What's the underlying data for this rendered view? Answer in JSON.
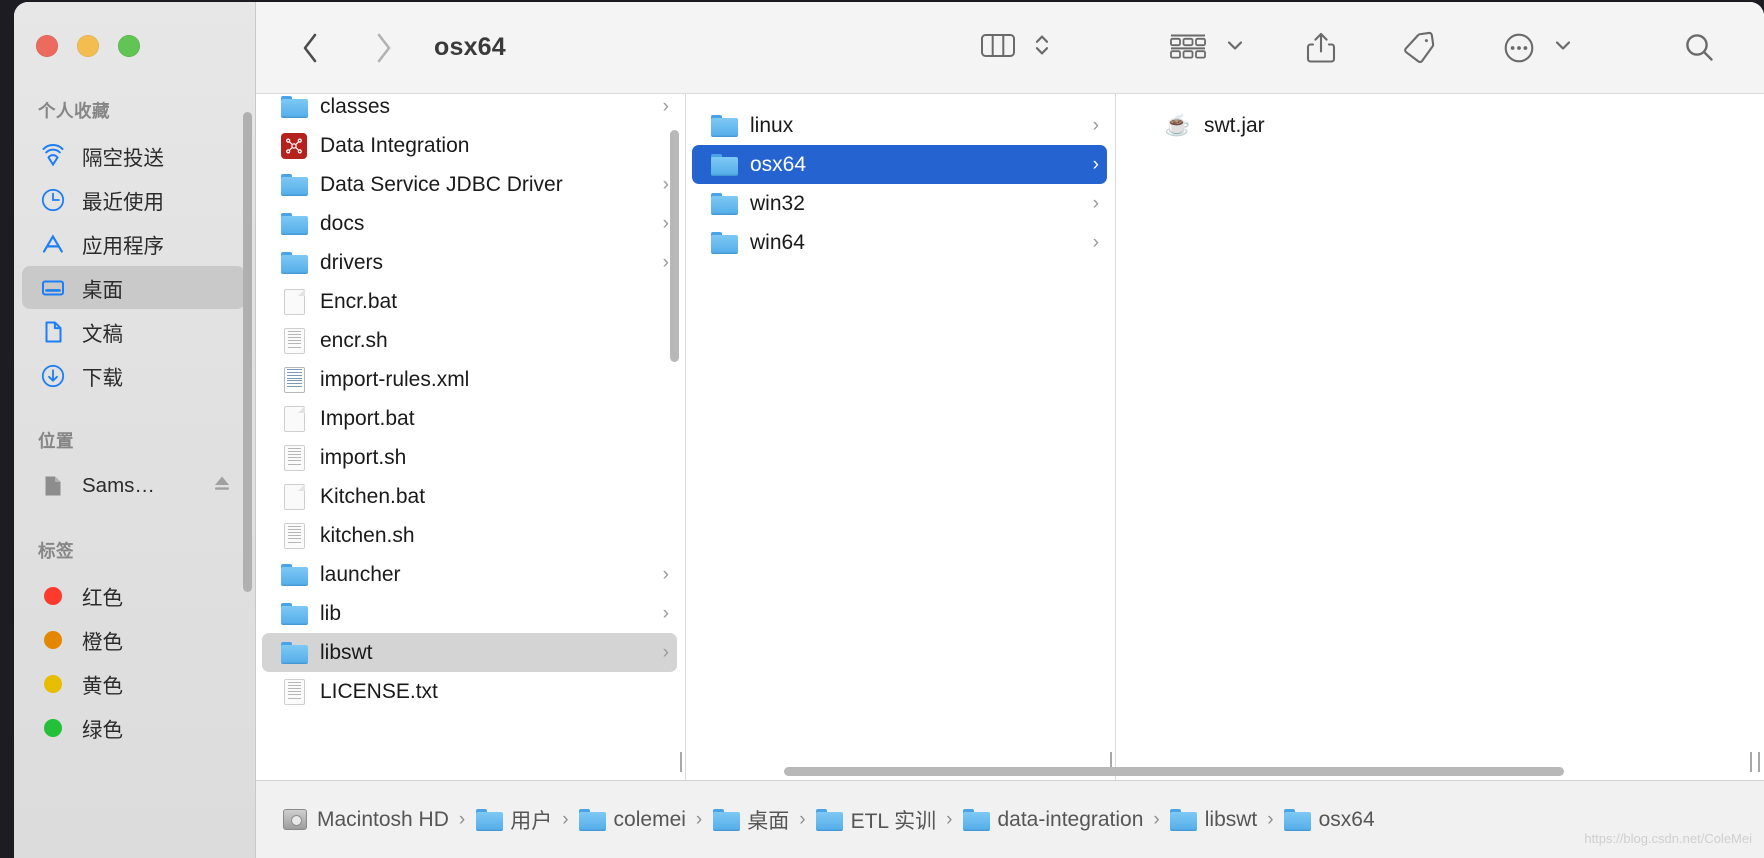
{
  "window": {
    "title": "osx64",
    "traffic_lights": [
      "close",
      "minimize",
      "zoom"
    ]
  },
  "toolbar": {
    "back_label": "‹",
    "forward_label": "›",
    "view_icon": "column-view-icon",
    "sort_icon": "group-by-icon",
    "share_icon": "share-icon",
    "tag_icon": "tag-icon",
    "more_icon": "more-ellipsis-icon",
    "search_icon": "search-icon"
  },
  "sidebar": {
    "sections": [
      {
        "header": "个人收藏",
        "items": [
          {
            "label": "隔空投送",
            "icon": "airdrop-icon",
            "selected": false
          },
          {
            "label": "最近使用",
            "icon": "clock-icon",
            "selected": false
          },
          {
            "label": "应用程序",
            "icon": "applications-icon",
            "selected": false
          },
          {
            "label": "桌面",
            "icon": "desktop-icon",
            "selected": true
          },
          {
            "label": "文稿",
            "icon": "documents-icon",
            "selected": false
          },
          {
            "label": "下载",
            "icon": "downloads-icon",
            "selected": false
          }
        ]
      },
      {
        "header": "位置",
        "items": [
          {
            "label": "Sams…",
            "icon": "disk-icon",
            "selected": false,
            "eject": true
          }
        ]
      },
      {
        "header": "标签",
        "items": [
          {
            "label": "红色",
            "icon": "tag-dot-icon",
            "color": "#fc3b2d",
            "selected": false
          },
          {
            "label": "橙色",
            "icon": "tag-dot-icon",
            "color": "#e38600",
            "selected": false
          },
          {
            "label": "黄色",
            "icon": "tag-dot-icon",
            "color": "#e8bc00",
            "selected": false
          },
          {
            "label": "绿色",
            "icon": "tag-dot-icon",
            "color": "#23c03a",
            "selected": false
          }
        ]
      }
    ]
  },
  "columns": [
    {
      "name": "column-1",
      "items": [
        {
          "label": "classes",
          "icon": "folder-icon",
          "disclosure": true,
          "selection": "none"
        },
        {
          "label": "Data Integration",
          "icon": "app-icon",
          "disclosure": false,
          "selection": "none"
        },
        {
          "label": "Data Service JDBC Driver",
          "icon": "folder-icon",
          "disclosure": true,
          "selection": "none"
        },
        {
          "label": "docs",
          "icon": "folder-icon",
          "disclosure": true,
          "selection": "none"
        },
        {
          "label": "drivers",
          "icon": "folder-icon",
          "disclosure": true,
          "selection": "none"
        },
        {
          "label": "Encr.bat",
          "icon": "document-icon",
          "disclosure": false,
          "selection": "none"
        },
        {
          "label": "encr.sh",
          "icon": "script-icon",
          "disclosure": false,
          "selection": "none"
        },
        {
          "label": "import-rules.xml",
          "icon": "xml-icon",
          "disclosure": false,
          "selection": "none"
        },
        {
          "label": "Import.bat",
          "icon": "document-icon",
          "disclosure": false,
          "selection": "none"
        },
        {
          "label": "import.sh",
          "icon": "script-icon",
          "disclosure": false,
          "selection": "none"
        },
        {
          "label": "Kitchen.bat",
          "icon": "document-icon",
          "disclosure": false,
          "selection": "none"
        },
        {
          "label": "kitchen.sh",
          "icon": "script-icon",
          "disclosure": false,
          "selection": "none"
        },
        {
          "label": "launcher",
          "icon": "folder-icon",
          "disclosure": true,
          "selection": "none"
        },
        {
          "label": "lib",
          "icon": "folder-icon",
          "disclosure": true,
          "selection": "none"
        },
        {
          "label": "libswt",
          "icon": "folder-icon",
          "disclosure": true,
          "selection": "gray"
        },
        {
          "label": "LICENSE.txt",
          "icon": "script-icon",
          "disclosure": false,
          "selection": "none"
        }
      ]
    },
    {
      "name": "column-2",
      "items": [
        {
          "label": "linux",
          "icon": "folder-icon",
          "disclosure": true,
          "selection": "none"
        },
        {
          "label": "osx64",
          "icon": "folder-icon",
          "disclosure": true,
          "selection": "blue"
        },
        {
          "label": "win32",
          "icon": "folder-icon",
          "disclosure": true,
          "selection": "none"
        },
        {
          "label": "win64",
          "icon": "folder-icon",
          "disclosure": true,
          "selection": "none"
        }
      ]
    },
    {
      "name": "column-3",
      "items": [
        {
          "label": "swt.jar",
          "icon": "jar-icon",
          "disclosure": false,
          "selection": "none"
        }
      ]
    }
  ],
  "pathbar": {
    "crumbs": [
      {
        "label": "Macintosh HD",
        "icon": "hard-disk-icon"
      },
      {
        "label": "用户",
        "icon": "users-folder-icon"
      },
      {
        "label": "colemei",
        "icon": "home-folder-icon"
      },
      {
        "label": "桌面",
        "icon": "desktop-folder-icon"
      },
      {
        "label": "ETL 实训",
        "icon": "folder-icon"
      },
      {
        "label": "data-integration",
        "icon": "folder-icon"
      },
      {
        "label": "libswt",
        "icon": "folder-icon"
      },
      {
        "label": "osx64",
        "icon": "folder-icon"
      }
    ],
    "separator": "›"
  },
  "watermark": "https://blog.csdn.net/ColeMei",
  "colors": {
    "selection_blue": "#2563d1",
    "selection_gray": "#d4d4d4",
    "sidebar_accent": "#1d7ef5"
  }
}
